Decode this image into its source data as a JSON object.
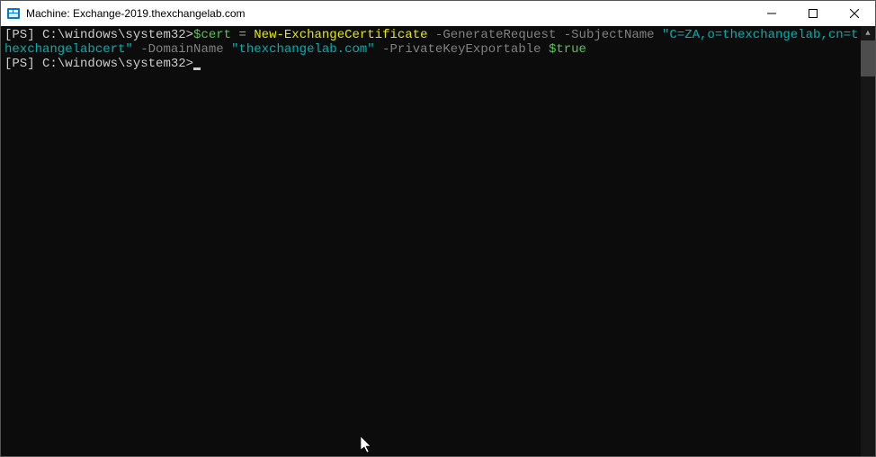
{
  "window": {
    "title": "Machine: Exchange-2019.thexchangelab.com"
  },
  "terminal": {
    "line1": {
      "prefix": "[PS] ",
      "path": "C:\\windows\\system32>",
      "var": "$cert",
      "op": " = ",
      "cmd": "New-ExchangeCertificate",
      "sp1": " ",
      "param1": "-GenerateRequest",
      "sp2": " ",
      "param2": "-SubjectName",
      "sp3": " ",
      "string1": "\"C=ZA,o=thexchangelab,cn=thexchangelabcert\"",
      "sp4": " ",
      "param3": "-DomainName",
      "sp5": " ",
      "string2": "\"thexchangelab.com\"",
      "sp6": " ",
      "param4": "-PrivateKeyExportable",
      "sp7": " ",
      "bool": "$true"
    },
    "line2": {
      "prefix": "[PS] ",
      "path": "C:\\windows\\system32>"
    }
  }
}
